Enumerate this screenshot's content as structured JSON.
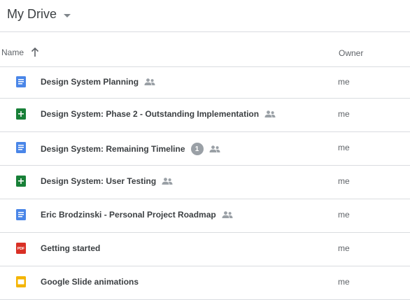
{
  "header": {
    "title": "My Drive"
  },
  "columns": {
    "name": "Name",
    "owner": "Owner"
  },
  "colors": {
    "doc": "#4a86e8",
    "sheet": "#188038",
    "pdf": "#d93025",
    "slides": "#f4b400",
    "share": "#9aa0a6"
  },
  "files": [
    {
      "name": "Design System Planning",
      "type": "doc",
      "icon": "google-docs-icon",
      "shared": true,
      "badge": "",
      "owner": "me"
    },
    {
      "name": "Design System: Phase 2 - Outstanding Implementation",
      "type": "sheet",
      "icon": "google-sheets-icon",
      "shared": true,
      "badge": "",
      "owner": "me"
    },
    {
      "name": "Design System: Remaining Timeline",
      "type": "doc",
      "icon": "google-docs-icon",
      "shared": true,
      "badge": "1",
      "owner": "me"
    },
    {
      "name": "Design System: User Testing",
      "type": "sheet",
      "icon": "google-sheets-icon",
      "shared": true,
      "badge": "",
      "owner": "me"
    },
    {
      "name": "Eric Brodzinski - Personal Project Roadmap",
      "type": "doc",
      "icon": "google-docs-icon",
      "shared": true,
      "badge": "",
      "owner": "me"
    },
    {
      "name": "Getting started",
      "type": "pdf",
      "icon": "pdf-icon",
      "shared": false,
      "badge": "",
      "owner": "me"
    },
    {
      "name": "Google Slide animations",
      "type": "slides",
      "icon": "google-slides-icon",
      "shared": false,
      "badge": "",
      "owner": "me"
    }
  ]
}
